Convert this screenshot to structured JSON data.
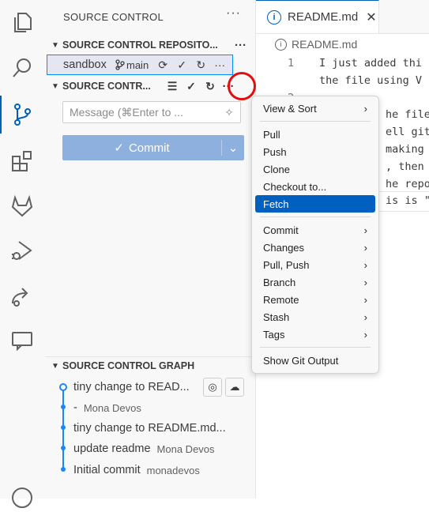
{
  "sidebar": {
    "title": "SOURCE CONTROL",
    "repositories_header": "SOURCE CONTROL REPOSITO...",
    "repo": {
      "name": "sandbox",
      "branch": "main"
    },
    "changes_header": "SOURCE CONTR...",
    "message_placeholder": "Message (⌘Enter to ...",
    "commit_label": "Commit",
    "graph_header": "SOURCE CONTROL GRAPH",
    "graph": [
      {
        "message": "tiny change to READ...",
        "author": ""
      },
      {
        "message": "-",
        "author": "Mona Devos"
      },
      {
        "message": "tiny change to README.md...",
        "author": ""
      },
      {
        "message": "update readme",
        "author": "Mona Devos"
      },
      {
        "message": "Initial commit",
        "author": "monadevos"
      }
    ]
  },
  "editor": {
    "tab_label": "README.md",
    "breadcrumb": "README.md",
    "lines": [
      {
        "num": "1",
        "text": "I just added thi"
      },
      {
        "num": "",
        "text": "the file using V"
      },
      {
        "num": "2",
        "text": ""
      },
      {
        "num": "",
        "text": "he file"
      },
      {
        "num": "",
        "text": "ell git"
      },
      {
        "num": "",
        "text": "making"
      },
      {
        "num": "",
        "text": ", then"
      },
      {
        "num": "",
        "text": "he repo"
      },
      {
        "num": "",
        "text": "is is \"p"
      }
    ]
  },
  "menu": {
    "items": [
      {
        "label": "View & Sort",
        "submenu": true
      },
      {
        "label": "Pull",
        "submenu": false
      },
      {
        "label": "Push",
        "submenu": false
      },
      {
        "label": "Clone",
        "submenu": false
      },
      {
        "label": "Checkout to...",
        "submenu": false
      },
      {
        "label": "Fetch",
        "submenu": false,
        "highlighted": true
      },
      {
        "label": "Commit",
        "submenu": true
      },
      {
        "label": "Changes",
        "submenu": true
      },
      {
        "label": "Pull, Push",
        "submenu": true
      },
      {
        "label": "Branch",
        "submenu": true
      },
      {
        "label": "Remote",
        "submenu": true
      },
      {
        "label": "Stash",
        "submenu": true
      },
      {
        "label": "Tags",
        "submenu": true
      },
      {
        "label": "Show Git Output",
        "submenu": false
      }
    ]
  },
  "icons": {
    "activity": [
      "explorer-icon",
      "search-icon",
      "source-control-icon",
      "extensions-icon",
      "gitlab-icon",
      "run-debug-icon",
      "remote-icon",
      "chat-icon"
    ]
  },
  "colors": {
    "accent": "#005fb8",
    "highlight": "#0060c0",
    "commit": "#8eb0de",
    "annotation": "#e0100f"
  }
}
